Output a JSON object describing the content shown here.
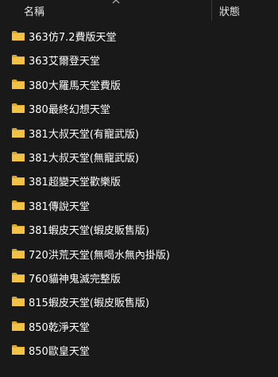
{
  "header": {
    "name_label": "名稱",
    "status_label": "狀態"
  },
  "icons": {
    "folder": "folder-icon",
    "sort": "chevron-up-icon"
  },
  "colors": {
    "background": "#191919",
    "folder": "#f3c244",
    "folder_dark": "#d9a72c",
    "text": "#ffffff"
  },
  "folders": [
    {
      "label": "363仿7.2費版天堂"
    },
    {
      "label": "363艾爾登天堂"
    },
    {
      "label": "380大羅馬天堂費版"
    },
    {
      "label": "380最終幻想天堂"
    },
    {
      "label": "381大叔天堂(有寵武版)"
    },
    {
      "label": "381大叔天堂(無寵武版)"
    },
    {
      "label": "381超變天堂歡樂版"
    },
    {
      "label": "381傳說天堂"
    },
    {
      "label": "381蝦皮天堂(蝦皮販售版)"
    },
    {
      "label": "720洪荒天堂(無喝水無內掛版)"
    },
    {
      "label": "760貓神鬼滅完整版"
    },
    {
      "label": "815蝦皮天堂(蝦皮販售版)"
    },
    {
      "label": "850乾淨天堂"
    },
    {
      "label": "850歐皇天堂"
    }
  ]
}
